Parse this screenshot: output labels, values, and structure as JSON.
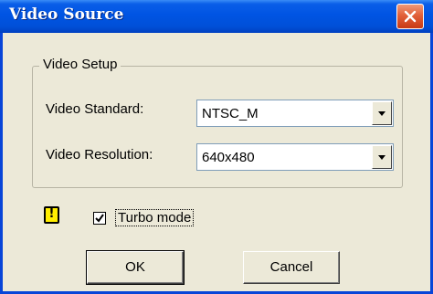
{
  "window": {
    "title": "Video Source",
    "close_icon": "close-icon"
  },
  "video_setup": {
    "group_label": "Video Setup",
    "standard": {
      "label": "Video Standard:",
      "value": "NTSC_M"
    },
    "resolution": {
      "label": "Video Resolution:",
      "value": "640x480"
    }
  },
  "turbo": {
    "warning_icon": "warning-icon",
    "warning_glyph": "!",
    "label": "Turbo mode",
    "checked": true
  },
  "buttons": {
    "ok": "OK",
    "cancel": "Cancel"
  },
  "colors": {
    "titlebar": "#0054e3",
    "close_button": "#e2603a",
    "dialog_background": "#ece9d8",
    "warning_icon": "#ffee00"
  }
}
